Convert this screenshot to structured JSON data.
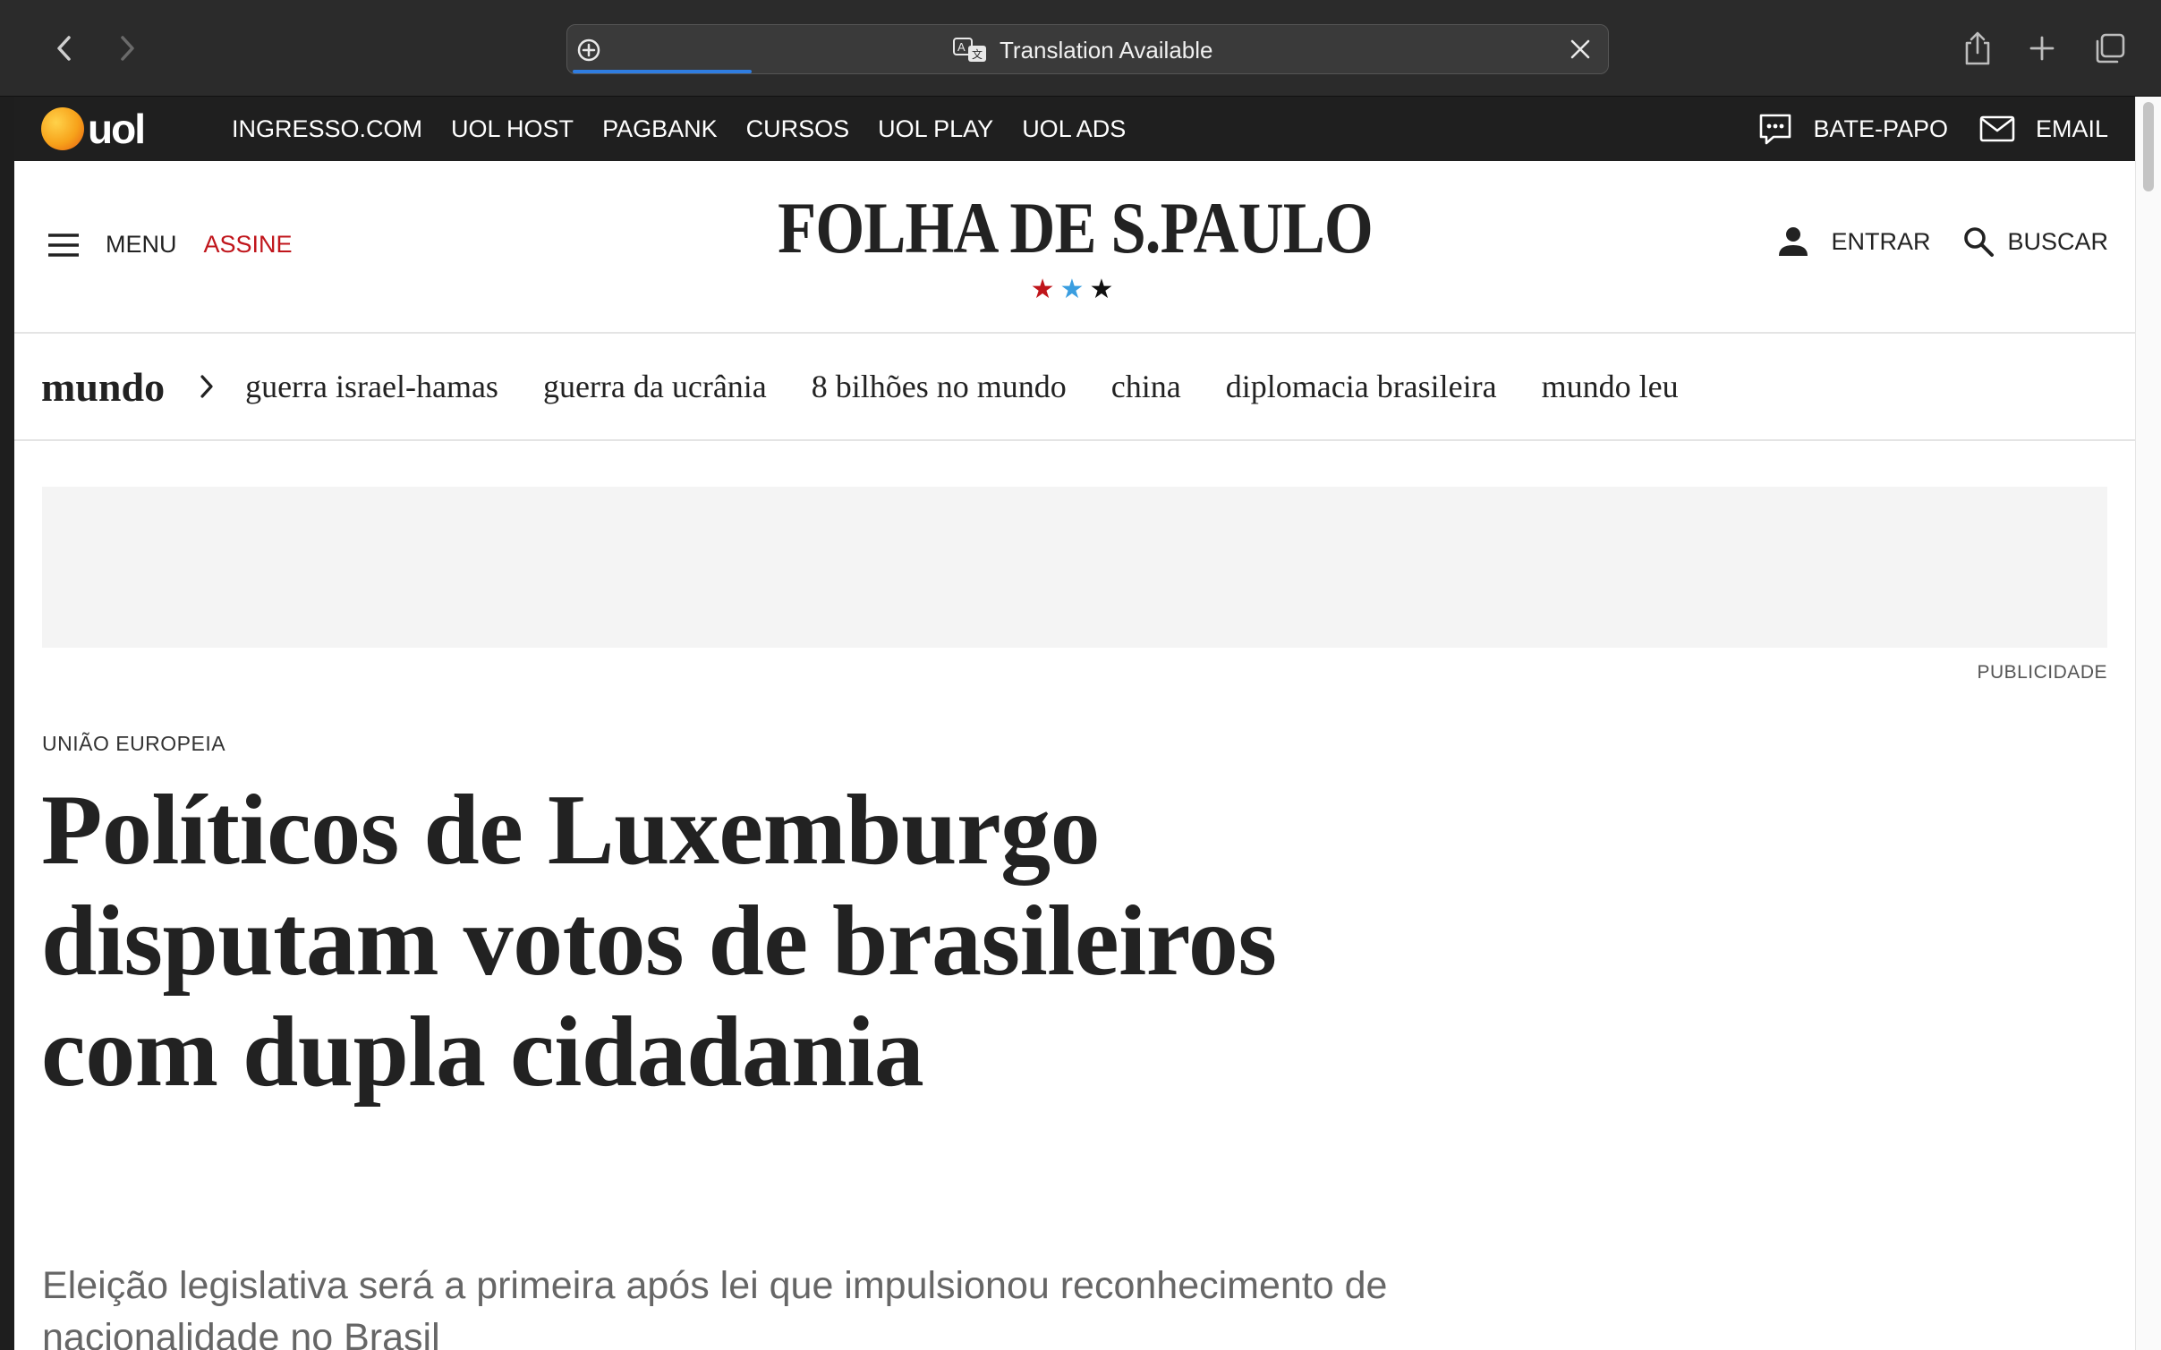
{
  "browser": {
    "address_bar_text": "Translation Available",
    "icons": [
      "chevron-left-icon",
      "chevron-right-icon",
      "site-settings-icon",
      "translate-icon",
      "close-icon",
      "share-icon",
      "new-tab-icon",
      "tab-overview-icon"
    ]
  },
  "uol_bar": {
    "logo_text": "uol",
    "links": [
      "INGRESSO.COM",
      "UOL HOST",
      "PAGBANK",
      "CURSOS",
      "UOL PLAY",
      "UOL ADS"
    ],
    "chat_label": "BATE-PAPO",
    "email_label": "EMAIL"
  },
  "header": {
    "menu_label": "MENU",
    "subscribe_label": "ASSINE",
    "brand": "FOLHA DE S.PAULO",
    "stars": [
      "★",
      "★",
      "★"
    ],
    "login_label": "ENTRAR",
    "search_label": "BUSCAR",
    "colors": {
      "subscribe": "#c0151b",
      "star_red": "#c0151b",
      "star_blue": "#3a9ee0",
      "star_black": "#111111"
    }
  },
  "section_nav": {
    "section": "mundo",
    "topics": [
      "guerra israel-hamas",
      "guerra da ucrânia",
      "8 bilhões no mundo",
      "china",
      "diplomacia brasileira",
      "mundo leu"
    ]
  },
  "ad": {
    "label": "PUBLICIDADE"
  },
  "article": {
    "kicker": "UNIÃO EUROPEIA",
    "headline": "Políticos de Luxemburgo disputam votos de brasileiros com dupla cidadania",
    "standfirst": "Eleição legislativa será a primeira após lei que impulsionou reconhecimento de nacionalidade no Brasil"
  }
}
